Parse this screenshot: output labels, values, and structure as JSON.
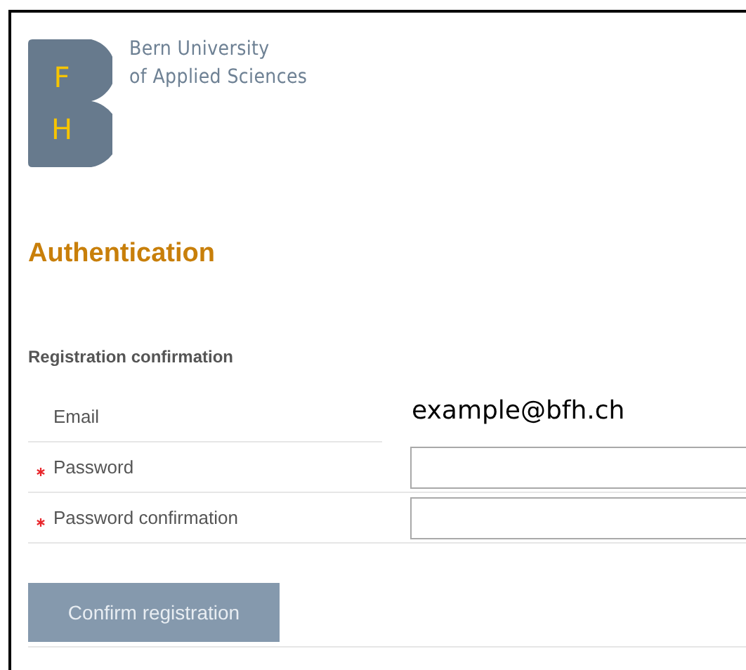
{
  "logo": {
    "letters": [
      "F",
      "H"
    ],
    "name_lines": [
      "Bern University",
      "of Applied Sciences"
    ]
  },
  "heading": "Authentication",
  "section_title": "Registration confirmation",
  "fields": [
    {
      "kind": "text",
      "label": "Email",
      "required": false,
      "value": "example@bfh.ch"
    },
    {
      "kind": "input",
      "label": "Password",
      "required": true
    },
    {
      "kind": "input",
      "label": "Password confirmation",
      "required": true
    }
  ],
  "submit": {
    "label": "Confirm registration",
    "disabled": true
  }
}
